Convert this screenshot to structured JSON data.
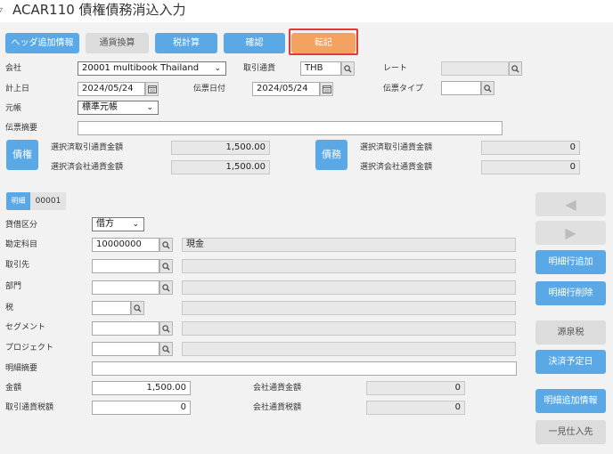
{
  "title": "ACAR110 債権債務消込入力",
  "toolbar": {
    "header_info": "ヘッダ追加情報",
    "currency_convert": "通貨換算",
    "tax_calc": "税計算",
    "confirm": "確認",
    "post": "転記"
  },
  "header": {
    "company_label": "会社",
    "company_value": "20001 multibook Thailand",
    "currency_label": "取引通貨",
    "currency_value": "THB",
    "rate_label": "レート",
    "rate_value": "",
    "posting_date_label": "計上日",
    "posting_date_value": "2024/05/24",
    "slip_date_label": "伝票日付",
    "slip_date_value": "2024/05/24",
    "slip_type_label": "伝票タイプ",
    "slip_type_value": "",
    "ledger_label": "元帳",
    "ledger_value": "標準元帳",
    "slip_memo_label": "伝票摘要",
    "slip_memo_value": ""
  },
  "receivable": {
    "tag": "債権",
    "sel_txn_label": "選択済取引通貨金額",
    "sel_txn_value": "1,500.00",
    "sel_co_label": "選択済会社通貨金額",
    "sel_co_value": "1,500.00"
  },
  "payable": {
    "tag": "債務",
    "sel_txn_label": "選択済取引通貨金額",
    "sel_txn_value": "0",
    "sel_co_label": "選択済会社通貨金額",
    "sel_co_value": "0"
  },
  "detail_tab": {
    "label": "明細",
    "number": "00001"
  },
  "detail": {
    "dc_label": "貸借区分",
    "dc_value": "借方",
    "account_label": "勘定科目",
    "account_code": "10000000",
    "account_name": "現金",
    "partner_label": "取引先",
    "dept_label": "部門",
    "tax_label": "税",
    "segment_label": "セグメント",
    "project_label": "プロジェクト",
    "memo_label": "明細摘要",
    "amount_label": "金額",
    "amount_value": "1,500.00",
    "co_amount_label": "会社通貨金額",
    "co_amount_value": "0",
    "txn_tax_label": "取引通貨税額",
    "txn_tax_value": "0",
    "co_tax_label": "会社通貨税額",
    "co_tax_value": "0"
  },
  "side_buttons": {
    "prev": "◀",
    "next": "▶",
    "add_row": "明細行追加",
    "delete_row": "明細行削除",
    "withholding": "源泉税",
    "due_date": "決済予定日",
    "detail_info": "明細追加情報",
    "one_time_vendor": "一見仕入先"
  },
  "colors": {
    "primary": "#5aa9e6",
    "accent": "#f4a261",
    "highlight": "#e53935"
  }
}
